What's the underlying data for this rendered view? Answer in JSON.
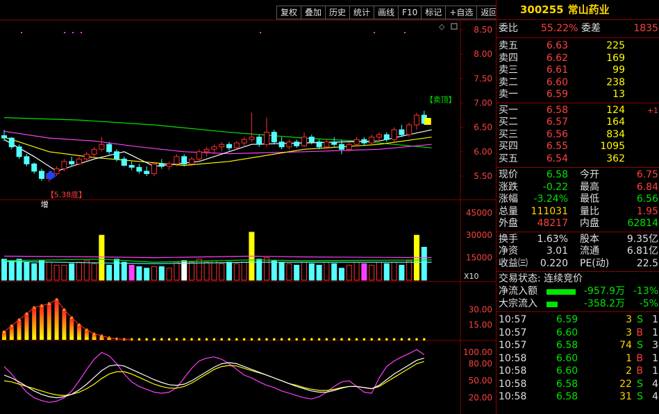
{
  "toolbar": [
    "复权",
    "叠加",
    "历史",
    "统计",
    "画线",
    "F10",
    "标记",
    "+自选",
    "返回"
  ],
  "stock": {
    "code": "300255",
    "name": "常山药业"
  },
  "weibi": {
    "label1": "委比",
    "value1": "55.22%",
    "label2": "委差",
    "value2": "1835"
  },
  "asks": [
    {
      "label": "卖五",
      "price": "6.63",
      "vol": "225",
      "chg": ""
    },
    {
      "label": "卖四",
      "price": "6.62",
      "vol": "169",
      "chg": ""
    },
    {
      "label": "卖三",
      "price": "6.61",
      "vol": "99",
      "chg": ""
    },
    {
      "label": "卖二",
      "price": "6.60",
      "vol": "238",
      "chg": ""
    },
    {
      "label": "卖一",
      "price": "6.59",
      "vol": "13",
      "chg": ""
    }
  ],
  "bids": [
    {
      "label": "买一",
      "price": "6.58",
      "vol": "124",
      "chg": "+1"
    },
    {
      "label": "买二",
      "price": "6.57",
      "vol": "164",
      "chg": ""
    },
    {
      "label": "买三",
      "price": "6.56",
      "vol": "834",
      "chg": ""
    },
    {
      "label": "买四",
      "price": "6.55",
      "vol": "1095",
      "chg": ""
    },
    {
      "label": "买五",
      "price": "6.54",
      "vol": "362",
      "chg": ""
    }
  ],
  "quote": [
    {
      "l1": "现价",
      "v1": "6.58",
      "c1": "green",
      "l2": "今开",
      "v2": "6.75",
      "c2": "red"
    },
    {
      "l1": "涨跌",
      "v1": "-0.22",
      "c1": "green",
      "l2": "最高",
      "v2": "6.84",
      "c2": "red"
    },
    {
      "l1": "涨幅",
      "v1": "-3.24%",
      "c1": "green",
      "l2": "最低",
      "v2": "6.56",
      "c2": "green"
    },
    {
      "l1": "总量",
      "v1": "111031",
      "c1": "gold",
      "l2": "量比",
      "v2": "1.95",
      "c2": "red"
    },
    {
      "l1": "外盘",
      "v1": "48217",
      "c1": "red",
      "l2": "内盘",
      "v2": "62814",
      "c2": "green"
    }
  ],
  "fundamentals": [
    {
      "l1": "换手",
      "v1": "1.63%",
      "l2": "股本",
      "v2": "9.35亿"
    },
    {
      "l1": "净资",
      "v1": "3.01",
      "l2": "流通",
      "v2": "6.81亿"
    },
    {
      "l1": "收益㈢",
      "v1": "0.220",
      "l2": "PE(动)",
      "v2": "22.5"
    }
  ],
  "trade_status": "交易状态: 连续竞价",
  "flows": [
    {
      "label": "净流入额",
      "value": "-957.9万",
      "pct": "-13%",
      "bar": 0.75
    },
    {
      "label": "大宗流入",
      "value": "-358.2万",
      "pct": "-5%",
      "bar": 0.28
    }
  ],
  "ticks": [
    {
      "time": "10:57",
      "price": "6.59",
      "vol": "3",
      "bs": "S",
      "n": "1"
    },
    {
      "time": "10:57",
      "price": "6.60",
      "vol": "3",
      "bs": "B",
      "n": "1"
    },
    {
      "time": "10:57",
      "price": "6.58",
      "vol": "74",
      "bs": "S",
      "n": "3"
    },
    {
      "time": "10:58",
      "price": "6.60",
      "vol": "1",
      "bs": "B",
      "n": "1"
    },
    {
      "time": "10:58",
      "price": "6.60",
      "vol": "2",
      "bs": "B",
      "n": "1"
    },
    {
      "time": "10:58",
      "price": "6.58",
      "vol": "22",
      "bs": "S",
      "n": "4"
    },
    {
      "time": "10:58",
      "price": "6.58",
      "vol": "31",
      "bs": "S",
      "n": "4"
    }
  ],
  "colors": {
    "up": "#ff3030",
    "down": "#54ffff",
    "grid": "#8b0000",
    "ma5": "#ffffff",
    "ma10": "#ffff00",
    "ma20": "#ff40ff",
    "ma60": "#00e600"
  },
  "chart_data": {
    "type": "candlestick",
    "price_axis": {
      "ticks": [
        "8.50",
        "8.00",
        "7.50",
        "7.00",
        "6.50",
        "6.00",
        "5.50"
      ],
      "min": 5.3,
      "max": 8.6
    },
    "annotations": {
      "low_label": "5.38底",
      "low_value": 5.38,
      "sell_label": "卖顶",
      "zeng_label": "增"
    },
    "candles": [
      [
        6.33,
        6.45,
        6.22,
        6.28
      ],
      [
        6.28,
        6.3,
        6.05,
        6.1
      ],
      [
        6.1,
        6.15,
        5.85,
        5.9
      ],
      [
        5.9,
        5.95,
        5.7,
        5.75
      ],
      [
        5.75,
        5.78,
        5.55,
        5.6
      ],
      [
        5.6,
        5.65,
        5.4,
        5.45
      ],
      [
        5.45,
        5.6,
        5.38,
        5.55
      ],
      [
        5.55,
        5.7,
        5.5,
        5.65
      ],
      [
        5.65,
        5.85,
        5.6,
        5.8
      ],
      [
        5.8,
        5.9,
        5.7,
        5.75
      ],
      [
        5.75,
        5.9,
        5.72,
        5.85
      ],
      [
        5.85,
        6.0,
        5.8,
        5.95
      ],
      [
        5.95,
        6.1,
        5.88,
        6.05
      ],
      [
        6.05,
        6.3,
        6.0,
        6.15
      ],
      [
        6.15,
        6.2,
        5.95,
        6.0
      ],
      [
        6.0,
        6.05,
        5.8,
        5.85
      ],
      [
        5.85,
        5.9,
        5.7,
        5.72
      ],
      [
        5.72,
        5.8,
        5.62,
        5.68
      ],
      [
        5.68,
        5.75,
        5.55,
        5.6
      ],
      [
        5.6,
        5.7,
        5.5,
        5.55
      ],
      [
        5.55,
        5.8,
        5.5,
        5.75
      ],
      [
        5.75,
        5.85,
        5.65,
        5.7
      ],
      [
        5.7,
        5.8,
        5.62,
        5.75
      ],
      [
        5.75,
        5.95,
        5.7,
        5.9
      ],
      [
        5.9,
        5.95,
        5.7,
        5.75
      ],
      [
        5.75,
        5.9,
        5.7,
        5.85
      ],
      [
        5.85,
        6.05,
        5.8,
        6.0
      ],
      [
        6.0,
        6.1,
        5.9,
        6.05
      ],
      [
        6.05,
        6.15,
        5.95,
        6.1
      ],
      [
        6.1,
        6.2,
        6.0,
        6.15
      ],
      [
        6.15,
        6.2,
        6.02,
        6.08
      ],
      [
        6.08,
        6.22,
        6.05,
        6.18
      ],
      [
        6.18,
        6.3,
        6.1,
        6.25
      ],
      [
        6.25,
        6.8,
        6.2,
        6.3
      ],
      [
        6.3,
        6.35,
        6.1,
        6.15
      ],
      [
        6.15,
        6.7,
        6.1,
        6.4
      ],
      [
        6.4,
        6.45,
        6.15,
        6.2
      ],
      [
        6.2,
        6.3,
        6.05,
        6.1
      ],
      [
        6.1,
        6.25,
        6.05,
        6.2
      ],
      [
        6.2,
        6.25,
        6.08,
        6.12
      ],
      [
        6.12,
        6.4,
        6.1,
        6.3
      ],
      [
        6.3,
        6.35,
        6.15,
        6.2
      ],
      [
        6.2,
        6.25,
        6.05,
        6.1
      ],
      [
        6.1,
        6.25,
        6.05,
        6.2
      ],
      [
        6.2,
        6.3,
        6.1,
        6.15
      ],
      [
        6.15,
        6.25,
        5.95,
        6.05
      ],
      [
        6.05,
        6.2,
        6.0,
        6.15
      ],
      [
        6.15,
        6.3,
        6.1,
        6.25
      ],
      [
        6.25,
        6.3,
        6.12,
        6.18
      ],
      [
        6.18,
        6.35,
        6.15,
        6.3
      ],
      [
        6.3,
        6.4,
        6.2,
        6.35
      ],
      [
        6.35,
        6.4,
        6.2,
        6.25
      ],
      [
        6.25,
        6.5,
        6.2,
        6.45
      ],
      [
        6.45,
        6.55,
        6.3,
        6.35
      ],
      [
        6.35,
        6.6,
        6.3,
        6.55
      ],
      [
        6.55,
        6.8,
        6.45,
        6.75
      ],
      [
        6.75,
        6.84,
        6.56,
        6.58
      ]
    ],
    "volume_axis": {
      "ticks": [
        "45000",
        "30000",
        "15000"
      ],
      "max": 50000,
      "unit": "X10"
    },
    "volumes": [
      14000,
      13000,
      14000,
      12000,
      11000,
      13000,
      12000,
      10000,
      10000,
      11000,
      12000,
      13000,
      11000,
      30000,
      10000,
      14000,
      12000,
      10000,
      9000,
      8000,
      9000,
      9000,
      8000,
      12000,
      13000,
      12000,
      14000,
      12000,
      13000,
      11000,
      12000,
      11000,
      12000,
      32000,
      14000,
      15000,
      13000,
      12000,
      11000,
      10000,
      12000,
      11000,
      10000,
      12000,
      11000,
      8000,
      10000,
      12000,
      11000,
      10000,
      12000,
      11000,
      12000,
      10000,
      13000,
      30000,
      22000
    ],
    "volume_special": {
      "13": "#ffff00",
      "33": "#ffff00",
      "55": "#ffff00",
      "17": "#ff40ff",
      "24": "#ffffff",
      "48": "#ff40ff"
    },
    "ind1_axis": {
      "ticks": [
        "30.00",
        "15.00"
      ],
      "max": 40
    },
    "ind1": [
      8,
      14,
      20,
      26,
      32,
      34,
      36,
      40,
      30,
      22,
      15,
      10,
      6,
      4,
      2,
      1,
      0.5,
      0.5,
      0.5,
      0.5,
      0.5,
      0.5,
      0.5,
      0.5,
      0.5,
      0.5,
      0.5,
      0.5,
      0.5,
      0.5,
      0.5,
      0.5,
      0.5,
      0.5,
      0.5,
      0.5,
      0.5,
      0.5,
      0.5,
      0.5,
      0.5,
      0.5,
      0.5,
      0.5,
      0.5,
      0.5,
      0.5,
      0.5,
      0.5,
      0.5,
      0.5,
      0.5,
      0.5,
      0.5,
      0.5,
      0.5,
      0.5
    ],
    "ind2_axis": {
      "ticks": [
        "100.00",
        "80.00",
        "50.00",
        "20.00"
      ],
      "min": 0,
      "max": 110
    },
    "ind2_k": [
      75,
      62,
      45,
      30,
      20,
      15,
      12,
      14,
      20,
      32,
      50,
      70,
      88,
      100,
      94,
      80,
      62,
      48,
      40,
      35,
      30,
      28,
      30,
      38,
      55,
      72,
      85,
      90,
      92,
      88,
      80,
      70,
      60,
      55,
      48,
      42,
      38,
      32,
      28,
      24,
      20,
      18,
      22,
      30,
      40,
      48,
      50,
      40,
      30,
      28,
      55,
      75,
      85,
      92,
      98,
      105,
      96
    ],
    "ind2_d": [
      50,
      48,
      44,
      40,
      36,
      32,
      28,
      25,
      24,
      26,
      30,
      36,
      44,
      54,
      62,
      66,
      66,
      62,
      56,
      50,
      44,
      40,
      37,
      37,
      40,
      46,
      54,
      62,
      70,
      75,
      77,
      76,
      72,
      68,
      64,
      60,
      55,
      50,
      45,
      42,
      38,
      35,
      33,
      33,
      35,
      38,
      40,
      40,
      38,
      36,
      40,
      48,
      56,
      64,
      72,
      80,
      84
    ],
    "ind2_j": [
      60,
      55,
      48,
      40,
      32,
      26,
      22,
      20,
      22,
      26,
      34,
      44,
      56,
      68,
      76,
      78,
      76,
      70,
      64,
      58,
      52,
      47,
      43,
      42,
      44,
      50,
      58,
      66,
      74,
      80,
      82,
      80,
      75,
      70,
      65,
      60,
      55,
      50,
      45,
      40,
      36,
      32,
      30,
      30,
      33,
      37,
      40,
      40,
      38,
      36,
      42,
      52,
      62,
      70,
      78,
      86,
      90
    ],
    "ma": {
      "ma60": [
        [
          0,
          6.7
        ],
        [
          10,
          6.65
        ],
        [
          20,
          6.55
        ],
        [
          30,
          6.4
        ],
        [
          40,
          6.28
        ],
        [
          47,
          6.22
        ],
        [
          57,
          6.08
        ]
      ],
      "ma20": [
        [
          0,
          6.42
        ],
        [
          6,
          6.28
        ],
        [
          12,
          6.22
        ],
        [
          18,
          6.1
        ],
        [
          24,
          6.0
        ],
        [
          30,
          5.96
        ],
        [
          40,
          6.0
        ],
        [
          50,
          6.05
        ],
        [
          57,
          6.15
        ]
      ],
      "ma10": [
        [
          0,
          6.3
        ],
        [
          6,
          6.0
        ],
        [
          12,
          5.88
        ],
        [
          18,
          5.8
        ],
        [
          24,
          5.72
        ],
        [
          30,
          5.8
        ],
        [
          40,
          6.05
        ],
        [
          50,
          6.15
        ],
        [
          57,
          6.3
        ]
      ],
      "ma5": [
        [
          0,
          6.25
        ],
        [
          4,
          5.9
        ],
        [
          7,
          5.6
        ],
        [
          12,
          5.85
        ],
        [
          16,
          6.0
        ],
        [
          20,
          5.7
        ],
        [
          26,
          5.8
        ],
        [
          33,
          6.15
        ],
        [
          40,
          6.18
        ],
        [
          50,
          6.22
        ],
        [
          57,
          6.45
        ]
      ]
    },
    "vol_ma": {
      "a": [
        [
          0,
          16000
        ],
        [
          13,
          15500
        ],
        [
          20,
          15000
        ],
        [
          33,
          16000
        ],
        [
          40,
          15500
        ],
        [
          57,
          15000
        ]
      ],
      "b": [
        [
          0,
          13000
        ],
        [
          13,
          14000
        ],
        [
          20,
          12000
        ],
        [
          33,
          13500
        ],
        [
          40,
          13000
        ],
        [
          57,
          13500
        ]
      ],
      "c": [
        [
          0,
          12500
        ],
        [
          20,
          11000
        ],
        [
          33,
          12000
        ],
        [
          57,
          12000
        ]
      ]
    }
  }
}
